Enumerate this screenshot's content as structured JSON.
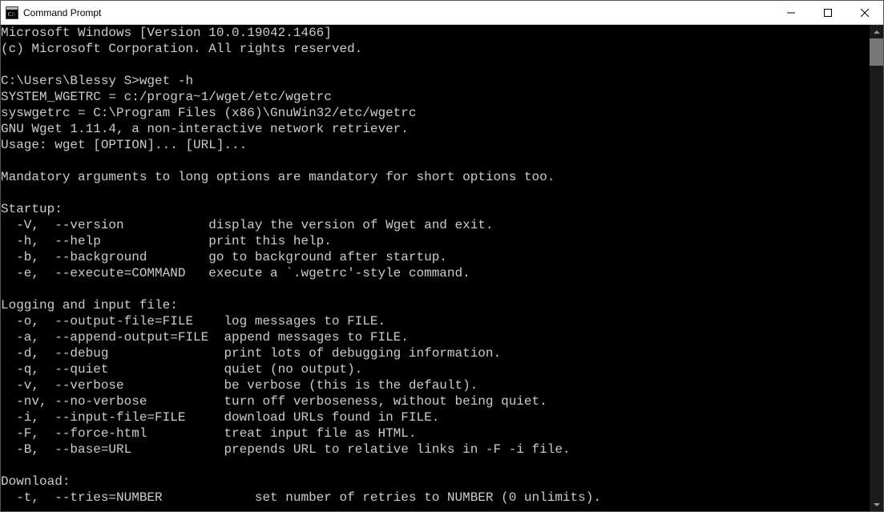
{
  "window": {
    "title": "Command Prompt"
  },
  "terminal": {
    "lines": [
      "Microsoft Windows [Version 10.0.19042.1466]",
      "(c) Microsoft Corporation. All rights reserved.",
      "",
      "C:\\Users\\Blessy S>wget -h",
      "SYSTEM_WGETRC = c:/progra~1/wget/etc/wgetrc",
      "syswgetrc = C:\\Program Files (x86)\\GnuWin32/etc/wgetrc",
      "GNU Wget 1.11.4, a non-interactive network retriever.",
      "Usage: wget [OPTION]... [URL]...",
      "",
      "Mandatory arguments to long options are mandatory for short options too.",
      "",
      "Startup:",
      "  -V,  --version           display the version of Wget and exit.",
      "  -h,  --help              print this help.",
      "  -b,  --background        go to background after startup.",
      "  -e,  --execute=COMMAND   execute a `.wgetrc'-style command.",
      "",
      "Logging and input file:",
      "  -o,  --output-file=FILE    log messages to FILE.",
      "  -a,  --append-output=FILE  append messages to FILE.",
      "  -d,  --debug               print lots of debugging information.",
      "  -q,  --quiet               quiet (no output).",
      "  -v,  --verbose             be verbose (this is the default).",
      "  -nv, --no-verbose          turn off verboseness, without being quiet.",
      "  -i,  --input-file=FILE     download URLs found in FILE.",
      "  -F,  --force-html          treat input file as HTML.",
      "  -B,  --base=URL            prepends URL to relative links in -F -i file.",
      "",
      "Download:",
      "  -t,  --tries=NUMBER            set number of retries to NUMBER (0 unlimits)."
    ]
  }
}
